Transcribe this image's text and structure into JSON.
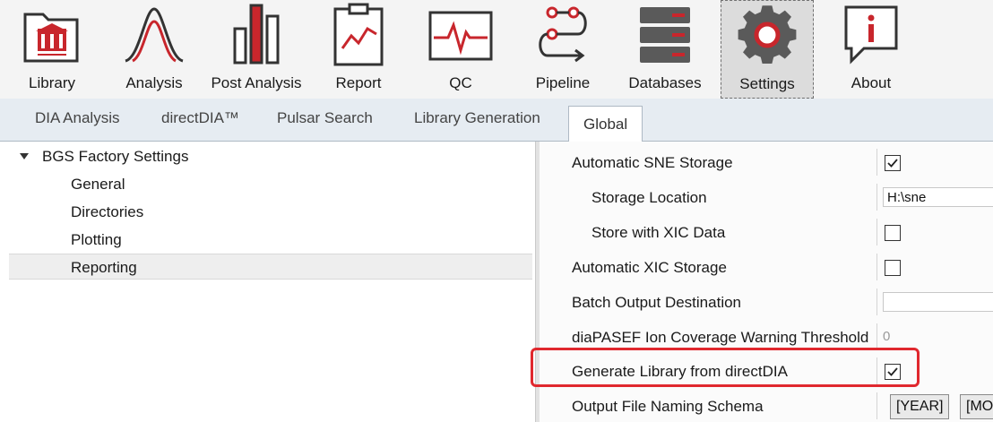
{
  "toolbar": {
    "items": [
      {
        "label": "Library",
        "icon": "library-folder-icon"
      },
      {
        "label": "Analysis",
        "icon": "peak-curve-icon"
      },
      {
        "label": "Post Analysis",
        "icon": "bar-chart-icon"
      },
      {
        "label": "Report",
        "icon": "clipboard-chart-icon"
      },
      {
        "label": "QC",
        "icon": "qc-signal-icon"
      },
      {
        "label": "Pipeline",
        "icon": "pipeline-flow-icon"
      },
      {
        "label": "Databases",
        "icon": "database-icon"
      },
      {
        "label": "Settings",
        "icon": "gear-icon"
      },
      {
        "label": "About",
        "icon": "info-bubble-icon"
      }
    ],
    "active": "Settings"
  },
  "subtabs": {
    "items": [
      "DIA Analysis",
      "directDIA™",
      "Pulsar Search",
      "Library Generation",
      "Global"
    ],
    "active": "Global"
  },
  "tree": {
    "root": "BGS Factory Settings",
    "children": [
      "General",
      "Directories",
      "Plotting",
      "Reporting"
    ],
    "selected": "Reporting"
  },
  "properties": [
    {
      "name": "Automatic SNE Storage",
      "type": "checkbox",
      "checked": true
    },
    {
      "name": "Storage Location",
      "type": "text",
      "value": "H:\\sne"
    },
    {
      "name": "Store with XIC Data",
      "type": "checkbox",
      "checked": false
    },
    {
      "name": "Automatic XIC Storage",
      "type": "checkbox",
      "checked": false
    },
    {
      "name": "Batch Output Destination",
      "type": "text",
      "value": ""
    },
    {
      "name": "diaPASEF Ion Coverage Warning Threshold",
      "type": "number",
      "value": "0"
    },
    {
      "name": "Generate Library from directDIA",
      "type": "checkbox",
      "checked": true
    },
    {
      "name": "Output File Naming Schema",
      "type": "tags",
      "tags": [
        "[YEAR]",
        "[MO"
      ]
    }
  ],
  "colors": {
    "accent_red": "#c8262c",
    "toolbar_bg": "#f4f4f4",
    "subtab_bg": "#e6ecf2",
    "highlight": "#e0282e"
  }
}
